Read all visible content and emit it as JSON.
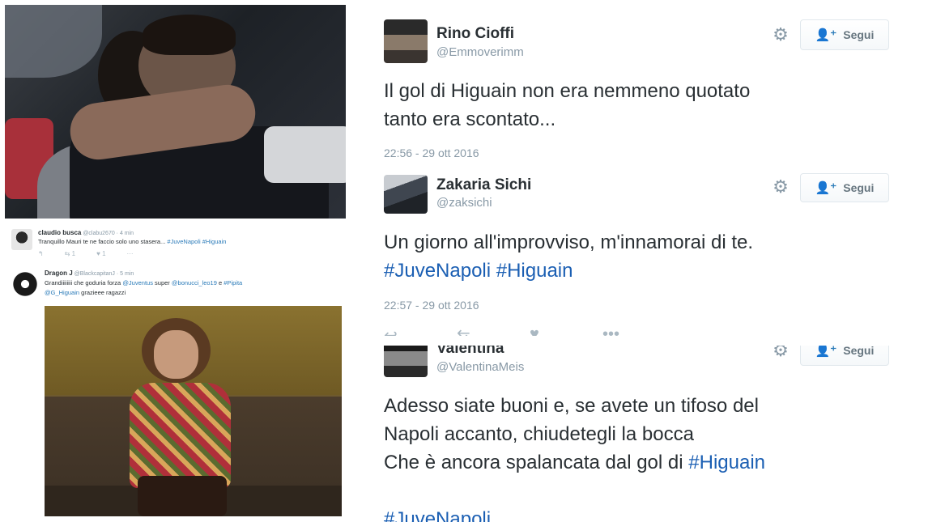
{
  "left": {
    "tweet1": {
      "name": "claudio busca",
      "handle": "@clabu2670 · 4 min",
      "text": "Tranquillo Mauri te ne faccio solo uno stasera...",
      "tags": "#JuveNapoli #Higuain",
      "retweets": "1",
      "likes": "1"
    },
    "tweet2": {
      "name": "Dragon J",
      "handle": "@BlackcapitanJ · 5 min",
      "text_a": "Grandiiiiiiii che goduria forza",
      "mention_1": "@Juventus",
      "text_b": "super",
      "mention_2": "@bonucci_leo19",
      "text_c": "e",
      "tag_1": "#Pipita",
      "mention_3": "@G_Higuain",
      "text_d": "grazieee ragazzi"
    }
  },
  "tweets": [
    {
      "name": "Rino Cioffi",
      "handle": "@Emmoverimm",
      "follow_label": "Segui",
      "text_line1": "Il gol di Higuain non era nemmeno quotato",
      "text_line2": "tanto era scontato...",
      "timestamp": "22:56 - 29 ott 2016"
    },
    {
      "name": "Zakaria Sichi",
      "handle": "@zaksichi",
      "follow_label": "Segui",
      "text_line1": "Un giorno all'improvviso, m'innamorai di te.",
      "hashtags": "#JuveNapoli #Higuain",
      "timestamp": "22:57 - 29 ott 2016"
    },
    {
      "name": "Valentina",
      "handle": "@ValentinaMeis",
      "follow_label": "Segui",
      "text_line1": "Adesso siate buoni e, se avete un tifoso del",
      "text_line2": "Napoli accanto, chiudetegli la bocca",
      "text_line3": "Che è ancora spalancata dal gol di",
      "hashtag": "#Higuain",
      "cut_tag": "#JuveNapoli"
    }
  ],
  "icons": {
    "reply": "reply-icon",
    "retweet": "retweet-icon",
    "like": "heart-icon",
    "more": "more-icon",
    "gear": "gear-icon",
    "follow": "add-user-icon"
  },
  "colors": {
    "hashtag": "#1b5fb3",
    "muted": "#8899a6",
    "text": "#292f33"
  }
}
